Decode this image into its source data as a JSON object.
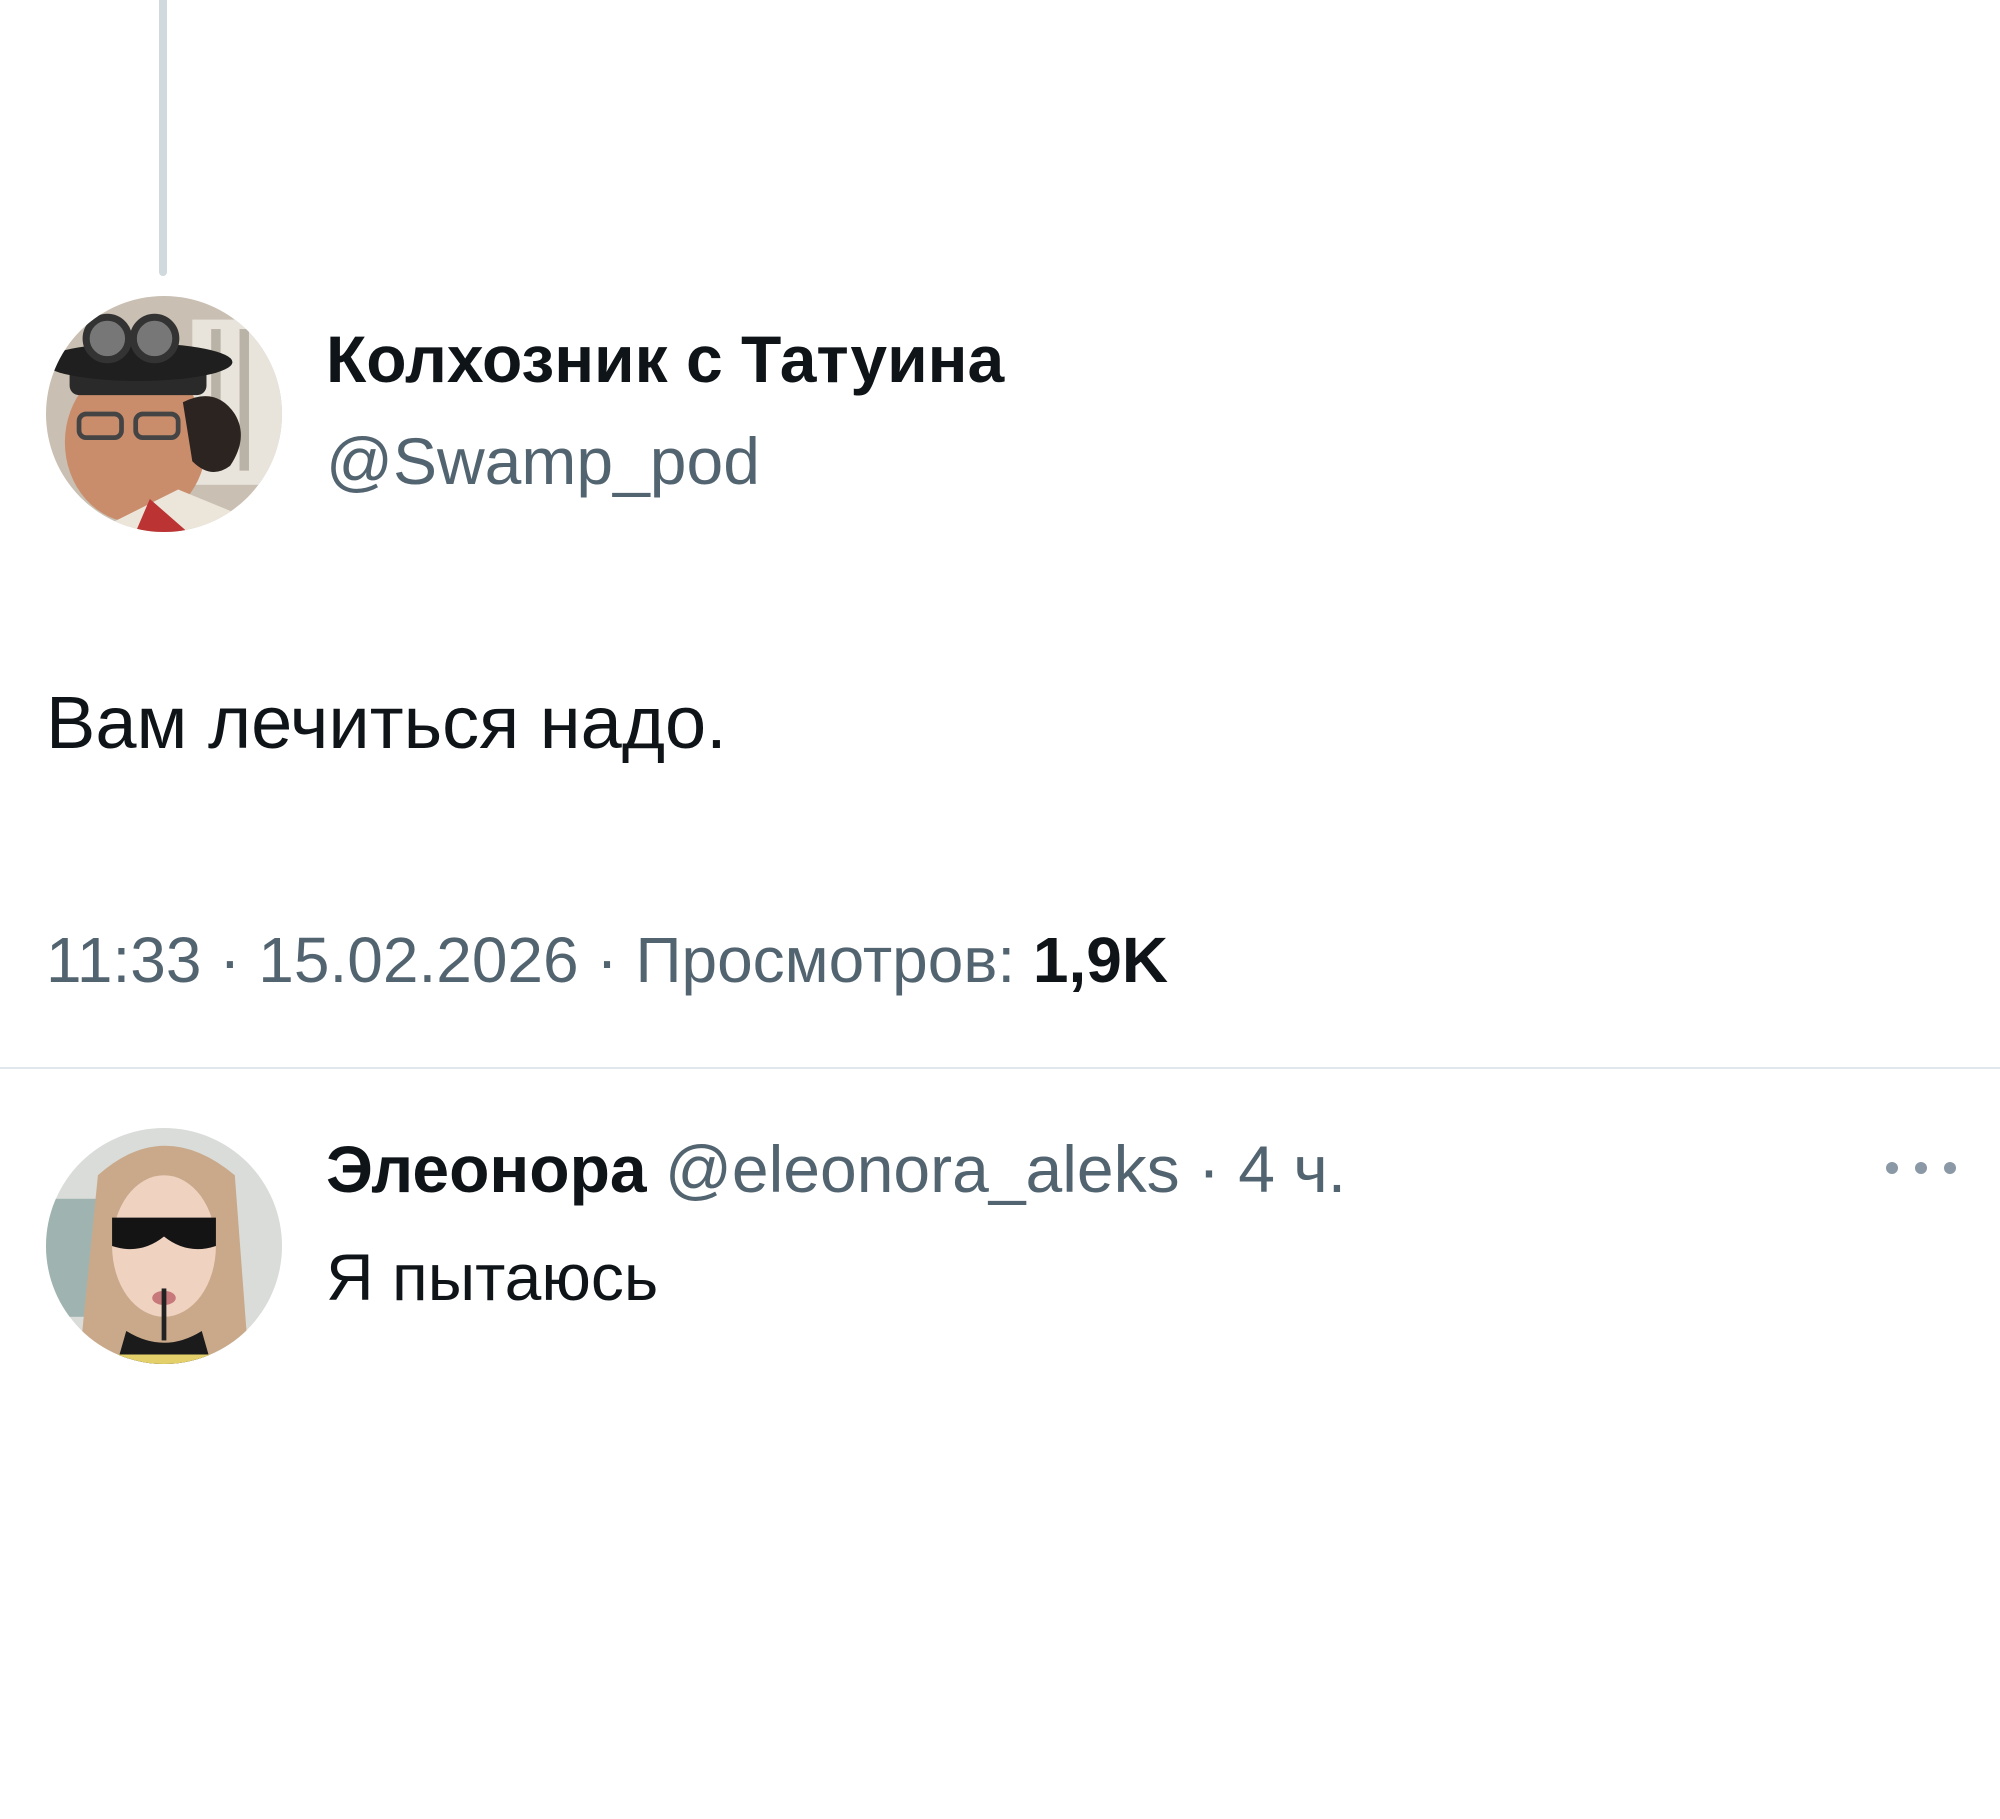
{
  "tweet": {
    "display_name": "Колхозник с Татуина",
    "handle": "@Swamp_pod",
    "text": "Вам лечиться надо.",
    "time": "11:33",
    "separator": "·",
    "date": "15.02.2026",
    "views_label": "Просмотров:",
    "views_count": "1,9K"
  },
  "reply": {
    "display_name": "Элеонора",
    "handle": "@eleonora_aleks",
    "separator": "·",
    "time_ago": "4 ч.",
    "text": "Я пытаюсь"
  },
  "icons": {
    "more": "more-horizontal-icon"
  },
  "colors": {
    "primary_text": "#0f1419",
    "secondary_text": "#536471",
    "divider": "#e1e8ed",
    "thread_line": "#cfd9de"
  }
}
